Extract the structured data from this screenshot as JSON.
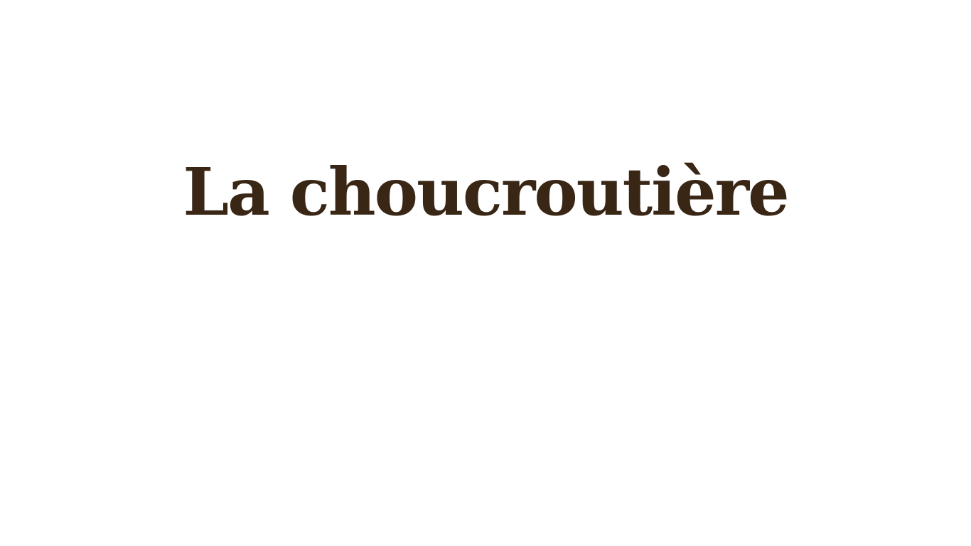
{
  "page": {
    "title": "La choucroutière",
    "colors": {
      "background": "#ffffff",
      "title_text": "#3a2615"
    }
  }
}
